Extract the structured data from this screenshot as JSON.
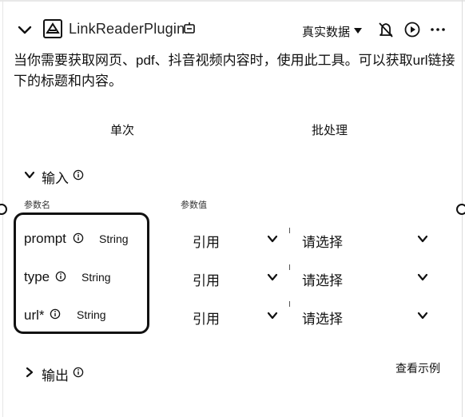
{
  "header": {
    "plugin_name": "LinkReaderPlugin",
    "data_mode": "真实数据",
    "icons": [
      "chevron-down-icon",
      "plugin-logo-icon",
      "plugin-badge-icon",
      "caret-down-icon",
      "bell-off-icon",
      "play-circle-icon",
      "more-icon"
    ]
  },
  "description": "当你需要获取网页、pdf、抖音视频内容时，使用此工具。可以获取url链接下的标题和内容。",
  "tabs": [
    {
      "label": "单次"
    },
    {
      "label": "批处理"
    }
  ],
  "input_section": {
    "title": "输入",
    "col_name": "参数名",
    "col_value": "参数值",
    "params": [
      {
        "name": "prompt",
        "type": "String",
        "ref": "引用",
        "placeholder": "请选择"
      },
      {
        "name": "type",
        "type": "String",
        "ref": "引用",
        "placeholder": "请选择"
      },
      {
        "name": "url*",
        "type": "String",
        "ref": "引用",
        "placeholder": "请选择"
      }
    ]
  },
  "output_section": {
    "title": "输出",
    "example_link": "查看示例"
  }
}
